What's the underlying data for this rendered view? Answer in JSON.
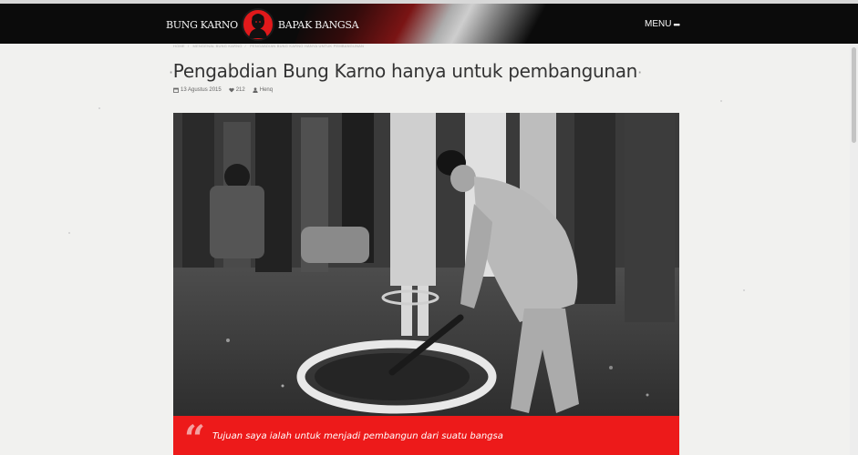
{
  "header": {
    "brand_left": "Bung Karno",
    "brand_right": "Bapak Bangsa",
    "menu_label": "MENU",
    "menu_dots": "•••"
  },
  "breadcrumb": [
    "Home",
    "Mengenal Bung Karno",
    "Pengabdian Bung Karno hanya untuk pembangunan"
  ],
  "article": {
    "title": "Pengabdian Bung Karno hanya untuk pembangunan",
    "date": "13 Agustus 2015",
    "likes": "212",
    "author": "Henq"
  },
  "quote": {
    "mark": "“",
    "text": "Tujuan saya ialah untuk menjadi pembangun dari suatu bangsa"
  },
  "colors": {
    "accent": "#ed1a1a",
    "header_bg": "#0b0b0b",
    "page_bg": "#f1f1ef"
  },
  "icons": [
    "calendar-icon",
    "heart-icon",
    "user-icon",
    "quote-icon",
    "menu-dots-icon"
  ]
}
